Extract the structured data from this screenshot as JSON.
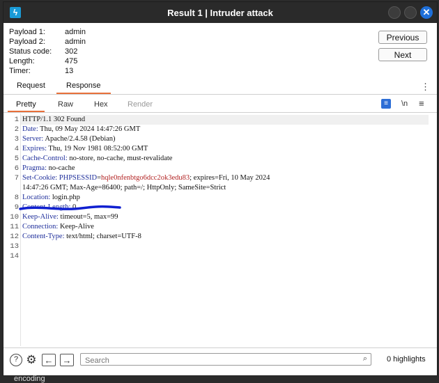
{
  "window": {
    "title": "Result 1 | Intruder attack",
    "app_icon": "burp-icon"
  },
  "info": {
    "rows": [
      {
        "label": "Payload 1:",
        "value": "admin"
      },
      {
        "label": "Payload 2:",
        "value": "admin"
      },
      {
        "label": "Status code:",
        "value": "302"
      },
      {
        "label": "Length:",
        "value": "475"
      },
      {
        "label": "Timer:",
        "value": "13"
      }
    ]
  },
  "nav": {
    "previous": "Previous",
    "next": "Next"
  },
  "main_tabs": [
    {
      "label": "Request"
    },
    {
      "label": "Response"
    }
  ],
  "view_tabs": [
    {
      "label": "Pretty"
    },
    {
      "label": "Raw"
    },
    {
      "label": "Hex"
    },
    {
      "label": "Render"
    }
  ],
  "tools": {
    "newline": "\\n",
    "menu": "≡"
  },
  "code_lines": [
    {
      "n": "1",
      "key": "",
      "text": "HTTP/1.1 302 Found"
    },
    {
      "n": "2",
      "key": "Date:",
      "text": " Thu, 09 May 2024 14:47:26 GMT"
    },
    {
      "n": "3",
      "key": "Server:",
      "text": " Apache/2.4.58 (Debian)"
    },
    {
      "n": "4",
      "key": "Expires:",
      "text": " Thu, 19 Nov 1981 08:52:00 GMT"
    },
    {
      "n": "5",
      "key": "Cache-Control:",
      "text": " no-store, no-cache, must-revalidate"
    },
    {
      "n": "6",
      "key": "Pragma:",
      "text": " no-cache"
    },
    {
      "n": "7",
      "key": "Set-Cookie:",
      "cookie": " PHPSESSID",
      "eq": "=",
      "val": "hqle0nfenbtgo6dcc2ok3edu83",
      "text": "; expires=Fri, 10 May 2024"
    },
    {
      "n": "",
      "key": "",
      "text": "14:47:26 GMT; Max-Age=86400; path=/; HttpOnly; SameSite=Strict"
    },
    {
      "n": "8",
      "key": "Location:",
      "text": " login.php"
    },
    {
      "n": "9",
      "key": "Content-Length:",
      "text": " 0"
    },
    {
      "n": "10",
      "key": "Keep-Alive:",
      "text": " timeout=5, max=99"
    },
    {
      "n": "11",
      "key": "Connection:",
      "text": " Keep-Alive"
    },
    {
      "n": "12",
      "key": "Content-Type:",
      "text": " text/html; charset=UTF-8"
    },
    {
      "n": "13",
      "key": "",
      "text": ""
    },
    {
      "n": "14",
      "key": "",
      "text": ""
    }
  ],
  "footer": {
    "search_placeholder": "Search",
    "highlights": "0 highlights"
  },
  "outside_text": "encoding",
  "colors": {
    "accent": "#e8703a",
    "header_key": "#1f2f9b",
    "cookie_value": "#b22222",
    "close_button": "#1e6fd9",
    "annotation_stroke": "#1020d0"
  }
}
